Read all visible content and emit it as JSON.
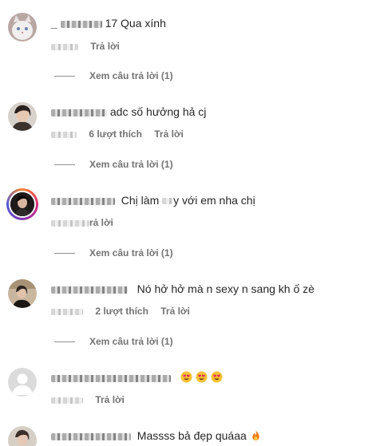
{
  "comments": [
    {
      "text": "17 Qua xính",
      "reply_label": "Trả lời",
      "view_replies": "Xem câu trả lời (1)"
    },
    {
      "text": "adc số hưởng hả cj",
      "likes": "6 lượt thích",
      "reply_label": "Trả lời",
      "view_replies": "Xem câu trả lời (1)"
    },
    {
      "text_a": "Chị làm",
      "text_b": "y với em nha chị",
      "reply_label": "rả lời",
      "view_replies": "Xem câu trả lời (1)"
    },
    {
      "text": "Nó hở hở mà n sexy n sang kh ố zè",
      "likes": "2 lượt thích",
      "reply_label": "Trả lời",
      "view_replies": "Xem câu trả lời (1)"
    },
    {
      "emojis": [
        "heart-eyes-emoji",
        "heart-eyes-emoji",
        "heart-eyes-emoji"
      ],
      "reply_label": "Trả lời"
    },
    {
      "text": "Massss bả đẹp quáaa",
      "emoji": "fire-emoji"
    }
  ],
  "colors": {
    "text": "#262626",
    "secondary": "#737373",
    "background": "#ffffff"
  }
}
